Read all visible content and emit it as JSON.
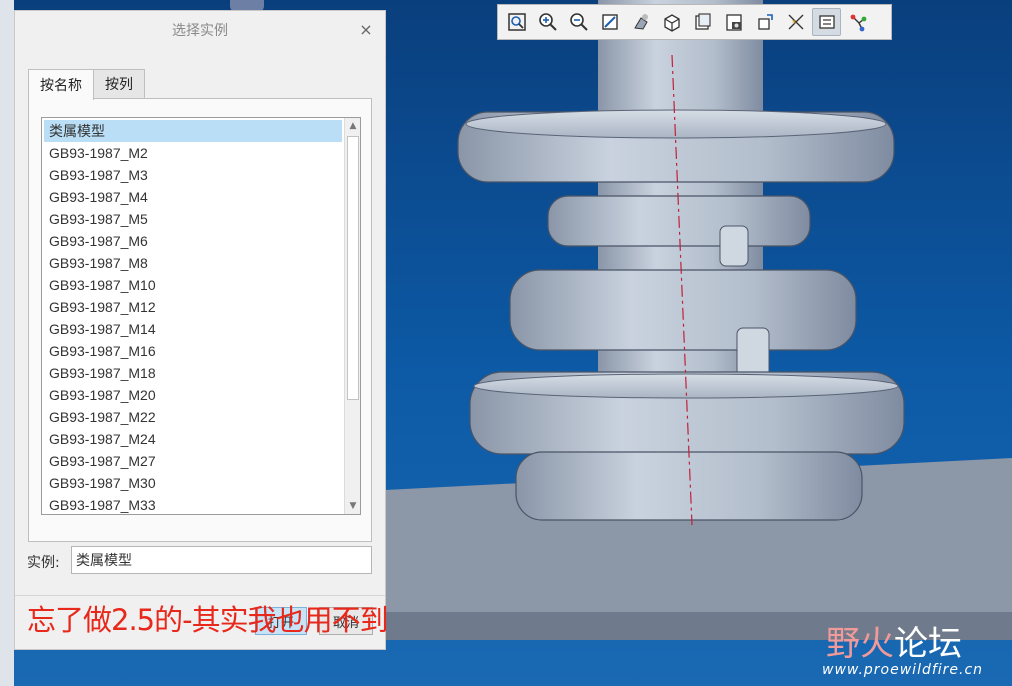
{
  "toolbar": {
    "icons": [
      "refit-icon",
      "zoom-in-icon",
      "zoom-out-icon",
      "repaint-icon",
      "display-style-icon",
      "standard-orientation-icon",
      "saved-views-icon",
      "view-manager-icon",
      "perspective-icon",
      "spin-center-icon",
      "annotation-display-icon",
      "datum-display-icon"
    ]
  },
  "dialog": {
    "title": "选择实例",
    "close_glyph": "×",
    "tabs": [
      {
        "label": "按名称"
      },
      {
        "label": "按列"
      }
    ],
    "list": {
      "items": [
        "类属模型",
        "GB93-1987_M2",
        "GB93-1987_M3",
        "GB93-1987_M4",
        "GB93-1987_M5",
        "GB93-1987_M6",
        "GB93-1987_M8",
        "GB93-1987_M10",
        "GB93-1987_M12",
        "GB93-1987_M14",
        "GB93-1987_M16",
        "GB93-1987_M18",
        "GB93-1987_M20",
        "GB93-1987_M22",
        "GB93-1987_M24",
        "GB93-1987_M27",
        "GB93-1987_M30",
        "GB93-1987_M33"
      ],
      "selected_index": 0
    },
    "instance_label": "实例:",
    "instance_value": "类属模型",
    "open_label": "打开",
    "cancel_label": "取消"
  },
  "overlay": {
    "caption": "忘了做2.5的-其实我也用不到",
    "watermark_logo_a": "野火",
    "watermark_logo_b": "论坛",
    "watermark_url": "www.proewildfire.cn"
  },
  "colors": {
    "caption": "#e8281b",
    "selection": "#b9def5",
    "background_top": "#0a3f7d",
    "background_bottom": "#1a69b3",
    "part_metal": "#b7c2d0"
  }
}
